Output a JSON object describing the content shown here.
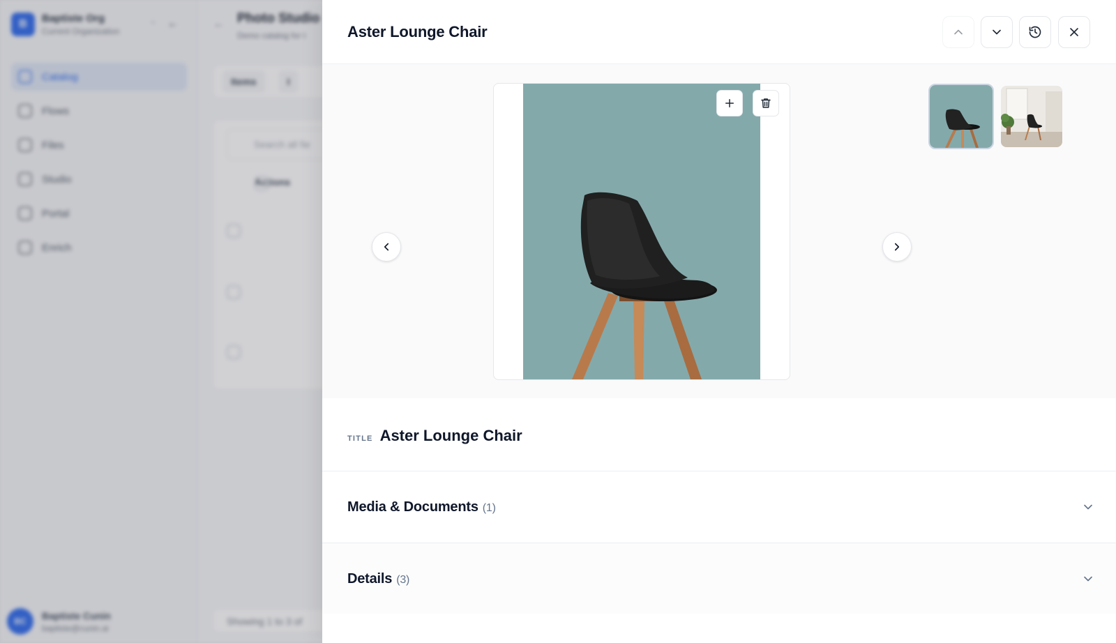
{
  "background": {
    "org": {
      "logo_letter": "B",
      "name": "Baptiste Org",
      "subtitle": "Current Organization"
    },
    "nav": [
      {
        "label": "Catalog",
        "active": true
      },
      {
        "label": "Flows",
        "active": false
      },
      {
        "label": "Files",
        "active": false
      },
      {
        "label": "Studio",
        "active": false
      },
      {
        "label": "Portal",
        "active": false
      },
      {
        "label": "Enrich",
        "active": false
      }
    ],
    "user": {
      "initials": "BC",
      "name": "Baptiste Cunin",
      "email": "baptiste@cunin.ai"
    },
    "page_title": "Photo Studio",
    "page_subtitle": "Demo catalog for t",
    "tabs": [
      "Items",
      "I"
    ],
    "search_placeholder": "Search all fie",
    "table_header": "Actions",
    "footer_text": "Showing 1 to 3 of"
  },
  "drawer": {
    "title": "Aster Lounge Chair",
    "header_buttons": {
      "prev": "chevron-up-icon",
      "next": "chevron-down-icon",
      "history": "history-icon",
      "close": "close-icon"
    },
    "gallery": {
      "image_count": 2,
      "selected_index": 0,
      "image_bg_color": "#84a9ab"
    },
    "title_field": {
      "label": "TITLE",
      "value": "Aster Lounge Chair"
    },
    "sections": [
      {
        "title": "Media & Documents",
        "count": "(1)"
      },
      {
        "title": "Details",
        "count": "(3)"
      }
    ]
  }
}
